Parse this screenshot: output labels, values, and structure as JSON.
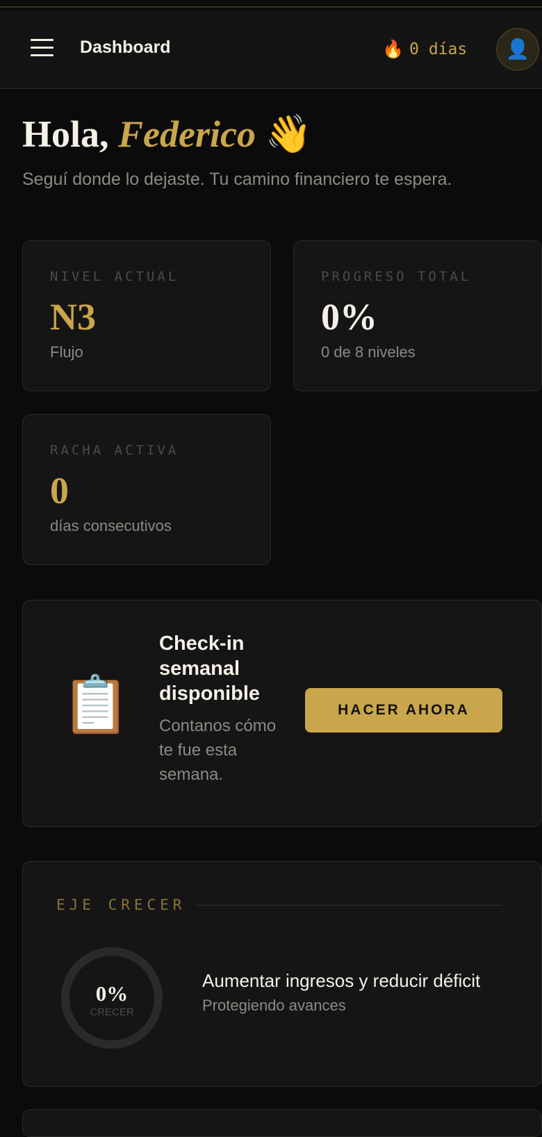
{
  "header": {
    "title": "Dashboard",
    "streak_icon": "fire-icon",
    "streak_text": "0 días",
    "avatar_icon": "user-icon",
    "menu_icon": "hamburger-menu-icon"
  },
  "greeting": {
    "prefix": "Hola, ",
    "name": "Federico",
    "emoji": "👋",
    "subtitle": "Seguí donde lo dejaste. Tu camino financiero te espera."
  },
  "stats": [
    {
      "label": "NIVEL ACTUAL",
      "value": "N3",
      "sub": "Flujo"
    },
    {
      "label": "PROGRESO TOTAL",
      "value": "0%",
      "sub": "0 de 8 niveles"
    },
    {
      "label": "RACHA ACTIVA",
      "value": "0",
      "sub": "días consecutivos"
    }
  ],
  "checkin": {
    "icon": "clipboard-icon",
    "title": "Check-in semanal disponible",
    "description": "Contanos cómo te fue esta semana.",
    "button": "HACER AHORA"
  },
  "axis": {
    "label": "EJE CRECER",
    "percent_text": "0%",
    "progress": 0,
    "ring_tag": "CRECER",
    "title": "Aumentar ingresos y reducir déficit",
    "subtitle": "Protegiendo avances"
  },
  "colors": {
    "accent": "#c9a54c",
    "background": "#0b0b0b",
    "card": "#151515"
  }
}
